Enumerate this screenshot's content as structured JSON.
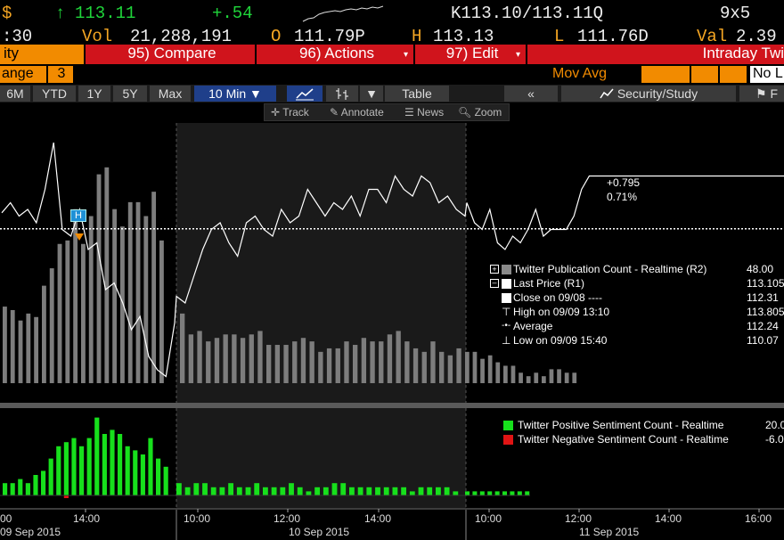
{
  "quote": {
    "currency_symbol": "$",
    "up_arrow": "↑",
    "last": "113.11",
    "change": "+.54",
    "bid_ask": "K113.10/113.11Q",
    "size": "9x5",
    "time": ":30",
    "vol_label": "Vol",
    "vol_value": "21,288,191",
    "open_label": "O",
    "open_value": "111.79P",
    "high_label": "H",
    "high_value": "113.13",
    "low_label": "L",
    "low_value": "111.76D",
    "val_label": "Val",
    "val_value": "2.39"
  },
  "function_bar": {
    "security_label": "ity",
    "compare_label": "95) Compare",
    "actions_label": "96) Actions",
    "edit_label": "97) Edit",
    "intraday_label": "Intraday Twi"
  },
  "range_bar": {
    "range_label": "ange",
    "range_value": "3",
    "mov_avg_label": "Mov Avg",
    "no_label": "No L"
  },
  "toolbar": {
    "periods": [
      "6M",
      "YTD",
      "1Y",
      "5Y",
      "Max"
    ],
    "interval": "10 Min ▼",
    "chart_type_icon": "line-chart-icon",
    "bar_type_icon": "ohlc-icon",
    "dropdown": "▼",
    "table_label": "Table",
    "collapse_label": "«",
    "security_study_label": "Security/Study",
    "flag_label": "F"
  },
  "subtoolbar": {
    "track_label": "Track",
    "annotate_label": "Annotate",
    "news_label": "News",
    "zoom_label": "Zoom"
  },
  "annotations": {
    "high_marker": "H",
    "change_value": "+0.795",
    "change_pct": "0.71%"
  },
  "legend_upper": [
    {
      "name": "Twitter Publication Count - Realtime (R2)",
      "value": "48.00",
      "color": "#8a8a8a",
      "icon": "plus-box-icon"
    },
    {
      "name": "Last Price (R1)",
      "value": "113.105",
      "color": "#ffffff",
      "icon": "minus-box-icon"
    },
    {
      "name": "Close on 09/08 ----",
      "value": "112.31",
      "color": "#ffffff",
      "icon": "none"
    },
    {
      "name": "High on 09/09 13:10",
      "value": "113.805",
      "color": "",
      "icon": "high-marker-icon"
    },
    {
      "name": "Average",
      "value": "112.24",
      "color": "",
      "icon": "average-line-icon"
    },
    {
      "name": "Low on 09/09 15:40",
      "value": "110.07",
      "color": "",
      "icon": "low-marker-icon"
    }
  ],
  "legend_lower": [
    {
      "name": "Twitter Positive Sentiment Count - Realtime",
      "value": "20.0",
      "color": "#17e01c"
    },
    {
      "name": "Twitter Negative Sentiment Count - Realtime",
      "value": "-6.0",
      "color": "#e01414"
    }
  ],
  "x_axis": {
    "time_labels": [
      "00",
      "14:00",
      "10:00",
      "12:00",
      "14:00",
      "10:00",
      "12:00",
      "14:00",
      "16:00"
    ],
    "date_labels": [
      "09 Sep 2015",
      "10 Sep 2015",
      "11 Sep 2015"
    ]
  },
  "colors": {
    "price_line": "#ffffff",
    "pub_bars": "#7d7d7d",
    "pos_bars": "#17e01c",
    "neg_bars": "#e01414",
    "accent_red": "#d0141c",
    "accent_orange": "#f28b00",
    "interval_blue": "#1f3f8a",
    "high_marker_bg": "#1e90d6",
    "low_marker_orange": "#f28b00"
  },
  "chart_data": {
    "type": "line",
    "xlabel": "",
    "ylabel": "",
    "price_series": {
      "name": "Last Price (R1)",
      "values": [
        112.55,
        112.7,
        112.5,
        112.6,
        112.4,
        112.9,
        113.6,
        112.3,
        112.2,
        112.6,
        112.0,
        112.1,
        111.4,
        111.5,
        111.2,
        110.8,
        111.0,
        110.4,
        110.2,
        110.1,
        110.9,
        111.3,
        111.2,
        111.6,
        112.0,
        112.3,
        112.4,
        112.1,
        111.9,
        112.4,
        112.5,
        112.3,
        112.2,
        112.6,
        112.4,
        112.5,
        112.9,
        112.7,
        112.5,
        112.7,
        112.6,
        112.8,
        112.5,
        112.9,
        112.9,
        112.7,
        113.1,
        112.9,
        112.8,
        113.1,
        113.0,
        112.7,
        112.8,
        112.6,
        112.5,
        112.7,
        112.4,
        112.3,
        112.6,
        112.1,
        112.0,
        112.2,
        112.1,
        112.3,
        112.6,
        112.2,
        112.3,
        112.3,
        112.3,
        112.5,
        112.9,
        113.1,
        113.1
      ]
    },
    "publication_count": {
      "name": "Twitter Publication Count - Realtime (R2)",
      "values": [
        22,
        21,
        18,
        20,
        19,
        28,
        33,
        40,
        41,
        50,
        40,
        48,
        60,
        62,
        50,
        45,
        52,
        52,
        48,
        55,
        41,
        20,
        14,
        15,
        12,
        13,
        14,
        14,
        13,
        14,
        15,
        11,
        11,
        11,
        12,
        13,
        12,
        9,
        10,
        10,
        12,
        11,
        13,
        12,
        12,
        14,
        15,
        12,
        10,
        9,
        12,
        9,
        8,
        10,
        9,
        9,
        7,
        8,
        6,
        5,
        5,
        3,
        2,
        3,
        2,
        4,
        4,
        3,
        3
      ]
    },
    "positive_sentiment": {
      "name": "Twitter Positive Sentiment Count - Realtime",
      "values": [
        3,
        3,
        4,
        3,
        5,
        6,
        9,
        12,
        13,
        14,
        12,
        14,
        19,
        15,
        16,
        15,
        12,
        11,
        10,
        14,
        9,
        7,
        3,
        2,
        3,
        3,
        2,
        2,
        3,
        2,
        2,
        3,
        2,
        2,
        2,
        3,
        2,
        1,
        2,
        2,
        3,
        3,
        2,
        2,
        2,
        2,
        2,
        2,
        2,
        1,
        2,
        2,
        2,
        2,
        1,
        1,
        1,
        1,
        1,
        1,
        1,
        1,
        1,
        1
      ]
    },
    "negative_sentiment": {
      "name": "Twitter Negative Sentiment Count - Realtime",
      "values": [
        0,
        0,
        0,
        0,
        0,
        0,
        0,
        0,
        -1,
        0,
        0,
        0,
        0,
        0,
        0,
        0,
        0,
        0,
        0,
        0,
        0,
        0,
        0,
        0,
        0,
        0,
        0,
        0,
        0,
        0,
        0,
        0,
        0,
        0,
        0,
        0,
        0,
        0,
        0,
        0,
        0,
        0,
        0,
        0,
        0,
        0,
        0,
        0,
        0,
        0,
        0,
        0,
        0,
        0,
        0,
        0,
        0,
        0,
        0,
        0,
        0,
        0,
        0,
        0
      ]
    },
    "reference_lines": {
      "close_on_0908": 112.31,
      "high": 113.805,
      "low": 110.07
    },
    "dates": [
      "09 Sep 2015",
      "10 Sep 2015",
      "11 Sep 2015"
    ]
  }
}
